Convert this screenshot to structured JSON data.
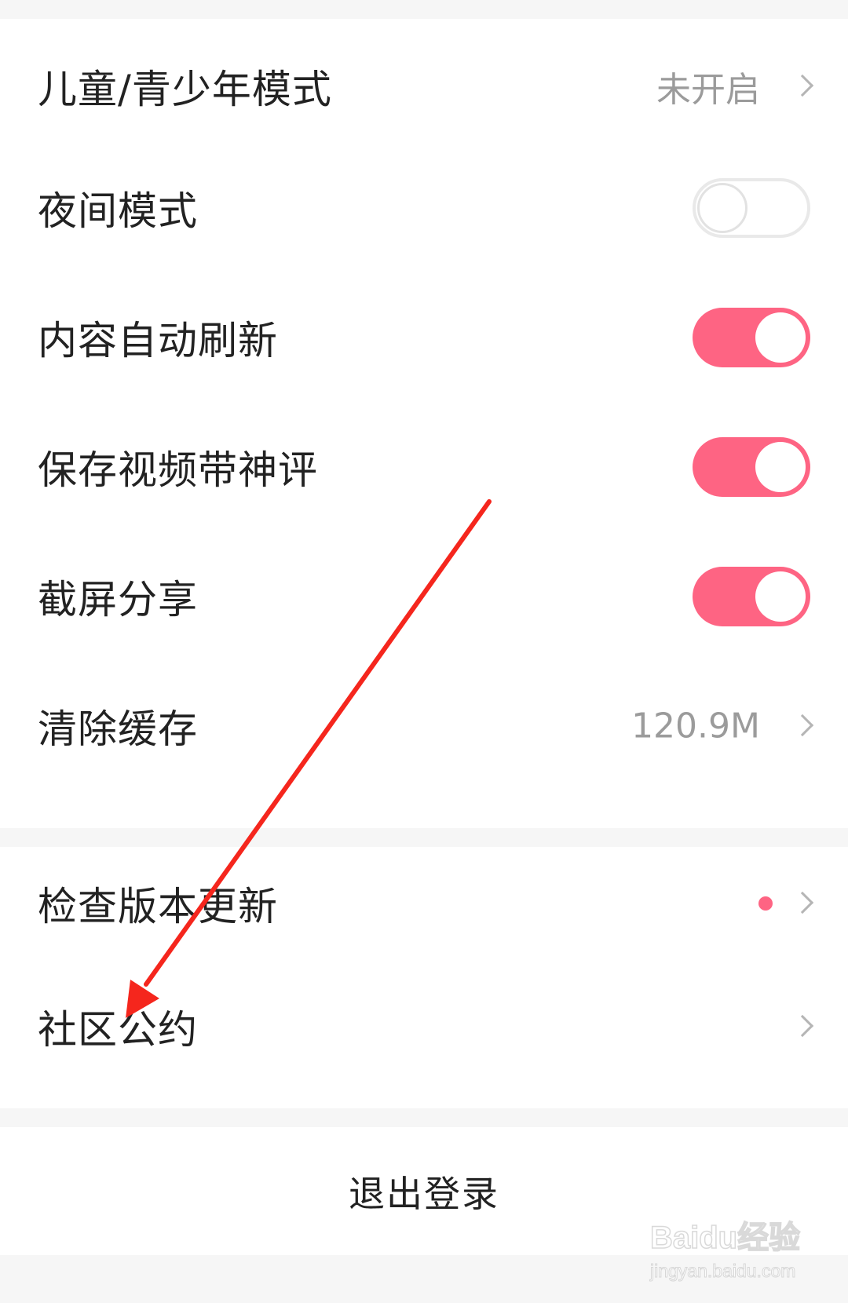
{
  "colors": {
    "accent": "#fe6483",
    "annotation_arrow": "#f5261d"
  },
  "settings": {
    "kids_mode": {
      "label": "儿童/青少年模式",
      "value": "未开启",
      "icon": "chevron-right-icon"
    },
    "night_mode": {
      "label": "夜间模式",
      "enabled": false
    },
    "auto_refresh": {
      "label": "内容自动刷新",
      "enabled": true
    },
    "save_video_comments": {
      "label": "保存视频带神评",
      "enabled": true
    },
    "screenshot_share": {
      "label": "截屏分享",
      "enabled": true
    },
    "clear_cache": {
      "label": "清除缓存",
      "value": "120.9M",
      "icon": "chevron-right-icon"
    }
  },
  "about": {
    "check_update": {
      "label": "检查版本更新",
      "badge": "new-dot",
      "icon": "chevron-right-icon"
    },
    "community_rules": {
      "label": "社区公约",
      "icon": "chevron-right-icon"
    }
  },
  "account": {
    "logout_label": "退出登录"
  },
  "watermark": {
    "logo_text": "Baidu经验",
    "url_text": "jingyan.baidu.com"
  }
}
